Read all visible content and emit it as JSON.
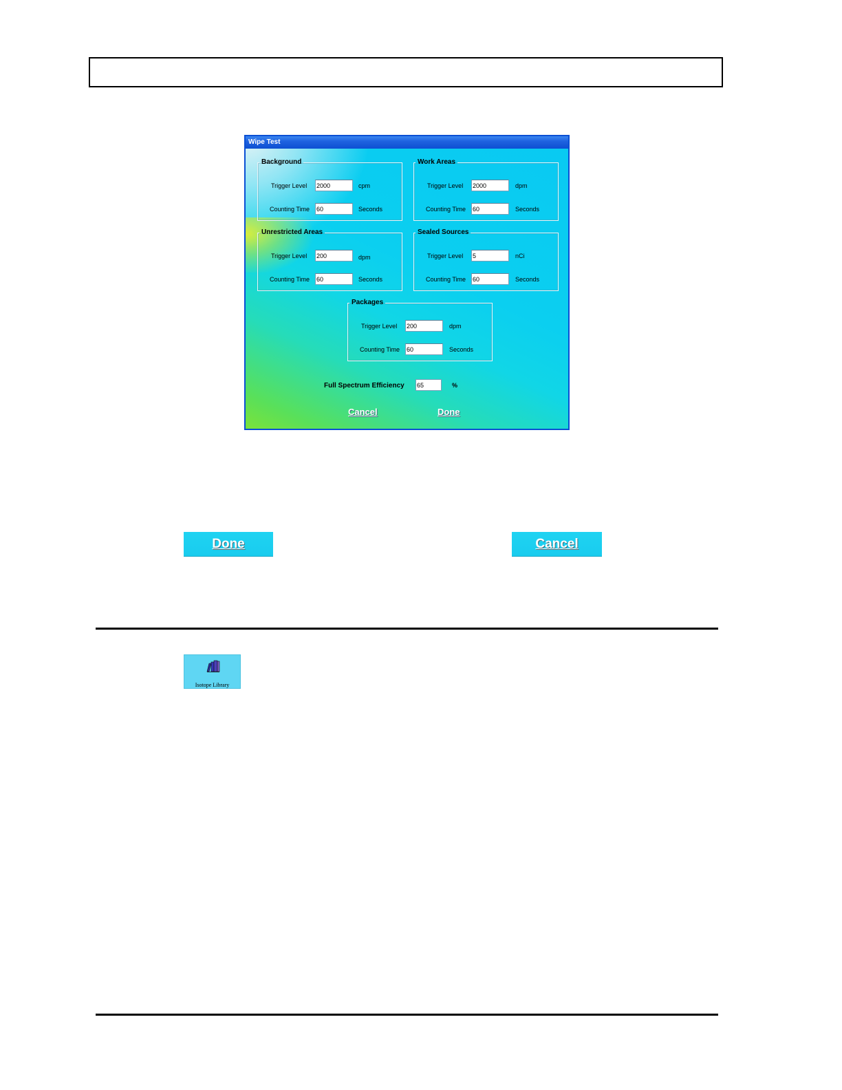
{
  "window": {
    "title": "Wipe Test"
  },
  "groups": {
    "background": {
      "legend": "Background",
      "trigger_label": "Trigger Level",
      "trigger_value": "2000",
      "trigger_unit": "cpm",
      "time_label": "Counting Time",
      "time_value": "60",
      "time_unit": "Seconds"
    },
    "work_areas": {
      "legend": "Work Areas",
      "trigger_label": "Trigger Level",
      "trigger_value": "2000",
      "trigger_unit": "dpm",
      "time_label": "Counting Time",
      "time_value": "60",
      "time_unit": "Seconds"
    },
    "unrestricted_areas": {
      "legend": "Unrestricted Areas",
      "trigger_label": "Trigger Level",
      "trigger_value": "200",
      "trigger_unit": "dpm",
      "time_label": "Counting Time",
      "time_value": "60",
      "time_unit": "Seconds"
    },
    "sealed_sources": {
      "legend": "Sealed Sources",
      "trigger_label": "Trigger Level",
      "trigger_value": "5",
      "trigger_unit": "nCi",
      "time_label": "Counting Time",
      "time_value": "60",
      "time_unit": "Seconds"
    },
    "packages": {
      "legend": "Packages",
      "trigger_label": "Trigger Level",
      "trigger_value": "200",
      "trigger_unit": "dpm",
      "time_label": "Counting Time",
      "time_value": "60",
      "time_unit": "Seconds"
    }
  },
  "efficiency": {
    "label": "Full Spectrum Efficiency",
    "value": "65",
    "unit": "%"
  },
  "dialog_buttons": {
    "cancel": "Cancel",
    "done": "Done"
  },
  "page_buttons": {
    "done": "Done",
    "cancel": "Cancel"
  },
  "isotope_library": {
    "label": "Isotope Library",
    "icon": "books-icon"
  },
  "colors": {
    "button": "#1fd3f2",
    "titlebar": "#1f63e0",
    "library_button": "#5fd6f3"
  }
}
